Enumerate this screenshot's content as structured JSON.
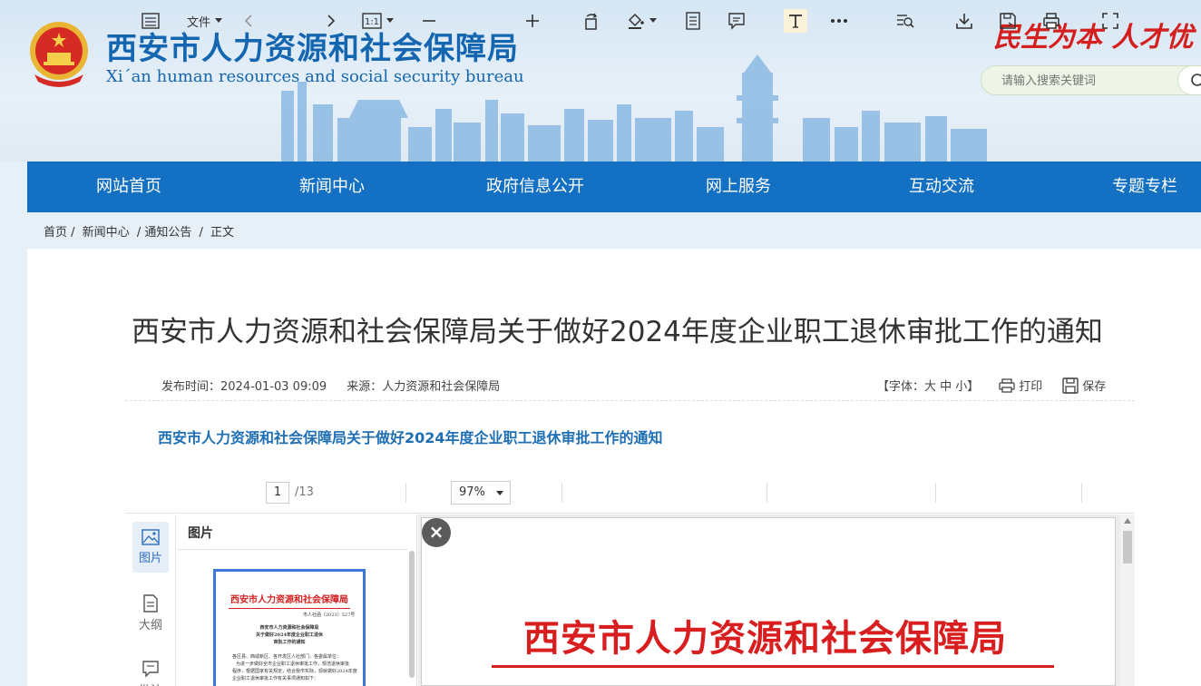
{
  "header": {
    "site_title": "西安市人力资源和社会保障局",
    "site_subtitle": "Xi´an human resources and social security bureau",
    "slogan": "民生为本 人才优",
    "search_placeholder": "请输入搜索关键词"
  },
  "nav": {
    "items": [
      {
        "label": "网站首页"
      },
      {
        "label": "新闻中心"
      },
      {
        "label": "政府信息公开"
      },
      {
        "label": "网上服务"
      },
      {
        "label": "互动交流"
      },
      {
        "label": "专题专栏"
      }
    ]
  },
  "breadcrumb": {
    "items": [
      "首页 /",
      "新闻中心",
      "/ 通知公告",
      "/",
      "正文"
    ]
  },
  "article": {
    "title": "西安市人力资源和社会保障局关于做好2024年度企业职工退休审批工作的通知",
    "publish_time": "发布时间：2024-01-03 09:09",
    "source": "来源：人力资源和社会保障局",
    "font_size_label": "【字体：大 中 小】",
    "print_label": "打印",
    "save_label": "保存",
    "sub_title": "西安市人力资源和社会保障局关于做好2024年度企业职工退休审批工作的通知"
  },
  "pdf_viewer": {
    "file_menu": "文件",
    "current_page": "1",
    "total_pages": "/13",
    "zoom": "97%",
    "sidebar": {
      "tabs": [
        {
          "label": "图片",
          "icon": "image-icon"
        },
        {
          "label": "大纲",
          "icon": "outline-icon"
        },
        {
          "label": "批注",
          "icon": "comment-icon"
        }
      ],
      "panel_title": "图片"
    },
    "thumbnail": {
      "header": "西安市人力资源和社会保障局",
      "doc_no": "市人社函〔2023〕527号",
      "title_lines": [
        "西安市人力资源和社会保障局",
        "关于做好2024年度企业职工退休",
        "审批工作的通知"
      ],
      "body_lines": [
        "各区县、西咸新区、各开发区人社部门，各委属单位：",
        "为进一步做好全市企业职工退休审批工作，规范退休审批",
        "程序，根据国家有关规定，结合我市实际，现就做好2024年度",
        "企业职工退休审批工作有关事项通知如下："
      ]
    },
    "page_header": "西安市人力资源和社会保障局"
  }
}
